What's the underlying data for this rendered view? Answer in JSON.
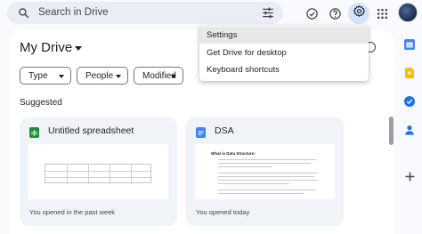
{
  "search": {
    "placeholder": "Search in Drive"
  },
  "header": {
    "icons": [
      "tune-icon",
      "ready-offline-icon",
      "help-icon",
      "settings-icon",
      "apps-icon",
      "avatar"
    ]
  },
  "main": {
    "title": "My Drive",
    "filters": [
      "Type",
      "People",
      "Modified"
    ],
    "section_label": "Suggested",
    "cards": [
      {
        "title": "Untitled spreadsheet",
        "meta": "You opened in the past week",
        "icon": "sheets-icon",
        "icon_color": "#1e8e3e"
      },
      {
        "title": "DSA",
        "meta": "You opened today",
        "icon": "docs-icon",
        "icon_color": "#4285f4",
        "preview_heading": "What is Data Structure:"
      }
    ]
  },
  "settings_menu": {
    "items": [
      "Settings",
      "Get Drive for desktop",
      "Keyboard shortcuts"
    ]
  },
  "side_rail": {
    "icons": [
      "calendar-icon",
      "keep-icon",
      "tasks-icon",
      "contacts-icon",
      "add-icon"
    ]
  },
  "colors": {
    "accent": "#0b57d0",
    "search_bg": "#e9eef6",
    "card_bg": "#f0f4f9",
    "settings_active": "#d3e3fd",
    "page_bg": "#f8fafd"
  }
}
